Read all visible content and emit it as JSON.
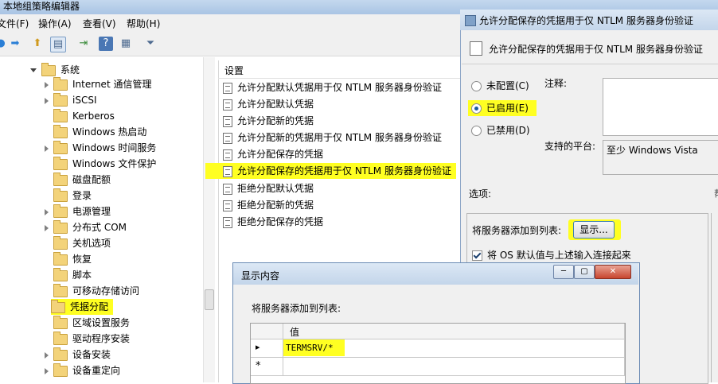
{
  "window": {
    "title": "本地组策略编辑器"
  },
  "menu": [
    "文件(F)",
    "操作(A)",
    "查看(V)",
    "帮助(H)"
  ],
  "tree": {
    "items": [
      {
        "label": "系统",
        "expander": "open"
      },
      {
        "label": "Internet 通信管理",
        "expander": "closed"
      },
      {
        "label": "iSCSI",
        "expander": "closed"
      },
      {
        "label": "Kerberos",
        "expander": "none"
      },
      {
        "label": "Windows 热启动",
        "expander": "none"
      },
      {
        "label": "Windows 时间服务",
        "expander": "closed"
      },
      {
        "label": "Windows 文件保护",
        "expander": "none"
      },
      {
        "label": "磁盘配额",
        "expander": "none"
      },
      {
        "label": "登录",
        "expander": "none"
      },
      {
        "label": "电源管理",
        "expander": "closed"
      },
      {
        "label": "分布式 COM",
        "expander": "closed"
      },
      {
        "label": "关机选项",
        "expander": "none"
      },
      {
        "label": "恢复",
        "expander": "none"
      },
      {
        "label": "脚本",
        "expander": "none"
      },
      {
        "label": "可移动存储访问",
        "expander": "none"
      },
      {
        "label": "凭据分配",
        "expander": "none",
        "highlighted": true
      },
      {
        "label": "区域设置服务",
        "expander": "none"
      },
      {
        "label": "驱动程序安装",
        "expander": "none"
      },
      {
        "label": "设备安装",
        "expander": "closed"
      },
      {
        "label": "设备重定向",
        "expander": "closed"
      }
    ]
  },
  "settings": {
    "header": "设置",
    "items": [
      {
        "label": "允许分配默认凭据用于仅 NTLM 服务器身份验证"
      },
      {
        "label": "允许分配默认凭据"
      },
      {
        "label": "允许分配新的凭据"
      },
      {
        "label": "允许分配新的凭据用于仅 NTLM 服务器身份验证"
      },
      {
        "label": "允许分配保存的凭据"
      },
      {
        "label": "允许分配保存的凭据用于仅 NTLM 服务器身份验证",
        "highlighted": true
      },
      {
        "label": "拒绝分配默认凭据"
      },
      {
        "label": "拒绝分配新的凭据"
      },
      {
        "label": "拒绝分配保存的凭据"
      }
    ]
  },
  "policy_dialog": {
    "title": "允许分配保存的凭据用于仅 NTLM 服务器身份验证",
    "heading": "允许分配保存的凭据用于仅 NTLM 服务器身份验证",
    "radio_not_configured": "未配置(C)",
    "radio_enabled": "已启用(E)",
    "radio_disabled": "已禁用(D)",
    "selected": "enabled",
    "comment_label": "注释:",
    "platform_label": "支持的平台:",
    "platform_value": "至少 Windows Vista",
    "options_label": "选项:",
    "add_servers_label": "将服务器添加到列表:",
    "show_button": "显示...",
    "concat_checkbox": "将 OS 默认值与上述输入连接起来",
    "concat_checked": true
  },
  "show_dialog": {
    "title": "显示内容",
    "list_label": "将服务器添加到列表:",
    "column_header": "值",
    "rows": [
      {
        "marker": "▸",
        "value": "TERMSRV/*"
      },
      {
        "marker": "*",
        "value": ""
      }
    ]
  },
  "colors": {
    "highlight": "#ffff22",
    "title_gradient": "#c3d5ea"
  }
}
